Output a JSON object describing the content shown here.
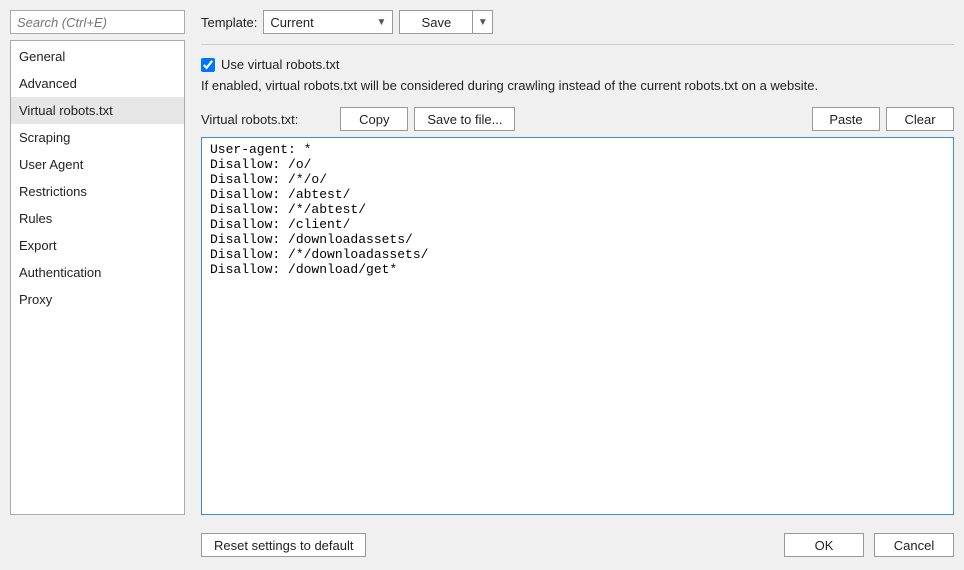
{
  "sidebar": {
    "search_placeholder": "Search (Ctrl+E)",
    "items": [
      {
        "label": "General",
        "selected": false
      },
      {
        "label": "Advanced",
        "selected": false
      },
      {
        "label": "Virtual robots.txt",
        "selected": true
      },
      {
        "label": "Scraping",
        "selected": false
      },
      {
        "label": "User Agent",
        "selected": false
      },
      {
        "label": "Restrictions",
        "selected": false
      },
      {
        "label": "Rules",
        "selected": false
      },
      {
        "label": "Export",
        "selected": false
      },
      {
        "label": "Authentication",
        "selected": false
      },
      {
        "label": "Proxy",
        "selected": false
      }
    ]
  },
  "template": {
    "label": "Template:",
    "selected": "Current",
    "save_label": "Save"
  },
  "virtual_robots": {
    "checkbox_label": "Use virtual robots.txt",
    "checked": true,
    "description": "If enabled, virtual robots.txt will be considered during crawling instead of the current robots.txt on a website.",
    "field_label": "Virtual robots.txt:",
    "copy_label": "Copy",
    "savefile_label": "Save to file...",
    "paste_label": "Paste",
    "clear_label": "Clear",
    "content": "User-agent: *\nDisallow: /o/\nDisallow: /*/o/\nDisallow: /abtest/\nDisallow: /*/abtest/\nDisallow: /client/\nDisallow: /downloadassets/\nDisallow: /*/downloadassets/\nDisallow: /download/get*"
  },
  "footer": {
    "reset_label": "Reset settings to default",
    "ok_label": "OK",
    "cancel_label": "Cancel"
  }
}
